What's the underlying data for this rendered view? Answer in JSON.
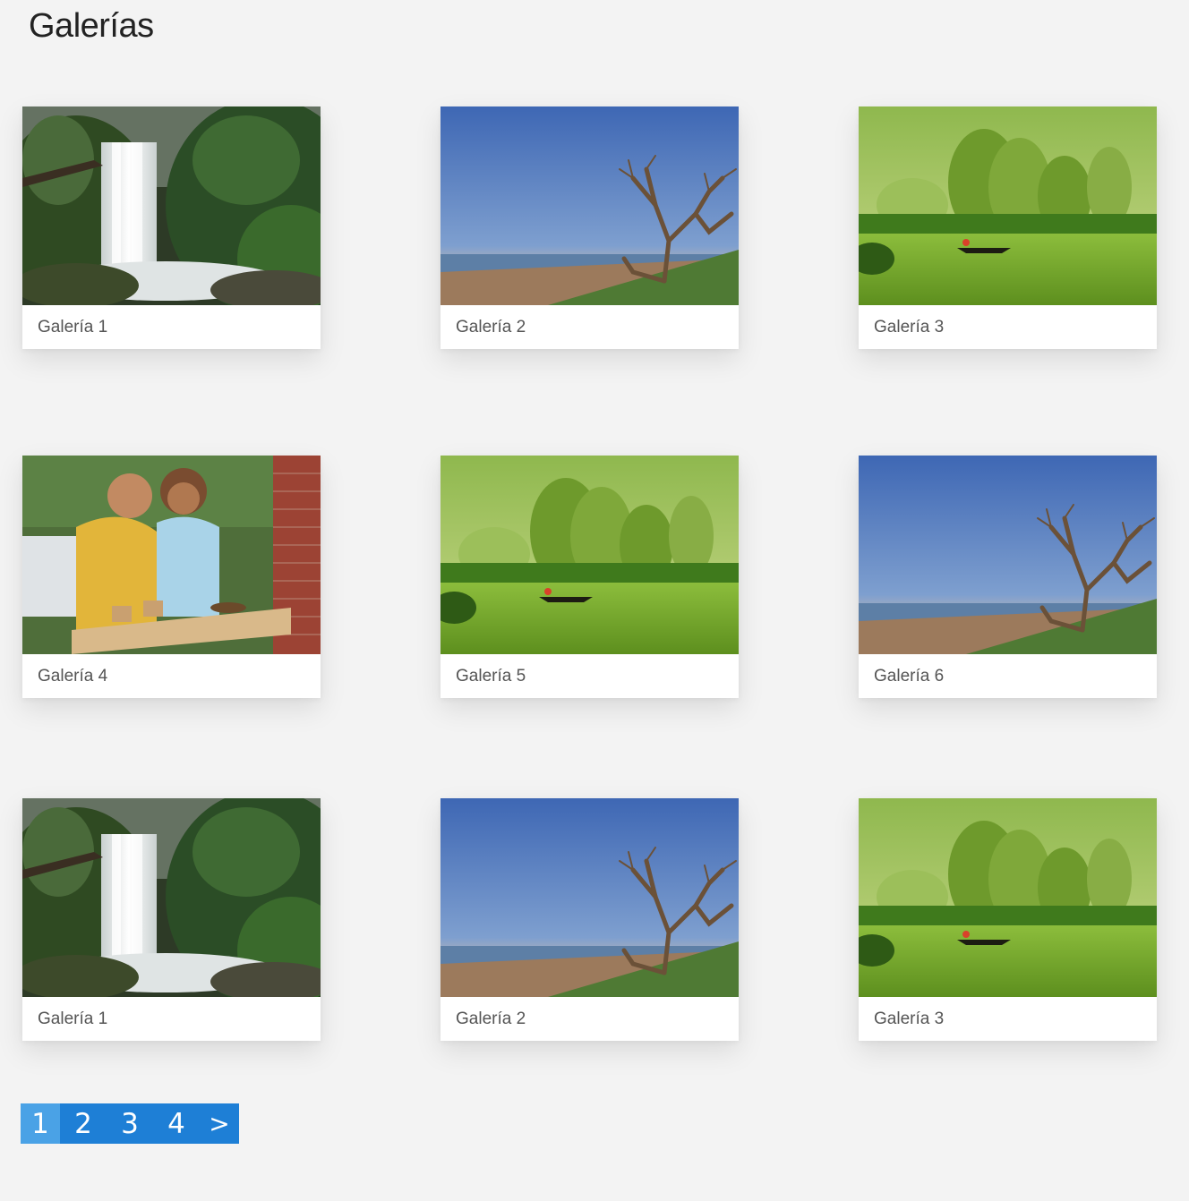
{
  "page": {
    "title": "Galerías"
  },
  "galleries": [
    {
      "label": "Galería 1",
      "image": "waterfall-forest"
    },
    {
      "label": "Galería 2",
      "image": "beach-driftwood-tree"
    },
    {
      "label": "Galería 3",
      "image": "green-lake-canoe"
    },
    {
      "label": "Galería 4",
      "image": "children-pinecones"
    },
    {
      "label": "Galería 5",
      "image": "green-lake-canoe"
    },
    {
      "label": "Galería 6",
      "image": "beach-driftwood-tree"
    },
    {
      "label": "Galería 1",
      "image": "waterfall-forest"
    },
    {
      "label": "Galería 2",
      "image": "beach-driftwood-tree"
    },
    {
      "label": "Galería 3",
      "image": "green-lake-canoe"
    }
  ],
  "pagination": {
    "pages": [
      "1",
      "2",
      "3",
      "4"
    ],
    "next_label": ">",
    "current": "1"
  },
  "colors": {
    "background": "#f3f3f3",
    "pagination": "#1e7fd6",
    "pagination_active": "#4aa2e6"
  }
}
